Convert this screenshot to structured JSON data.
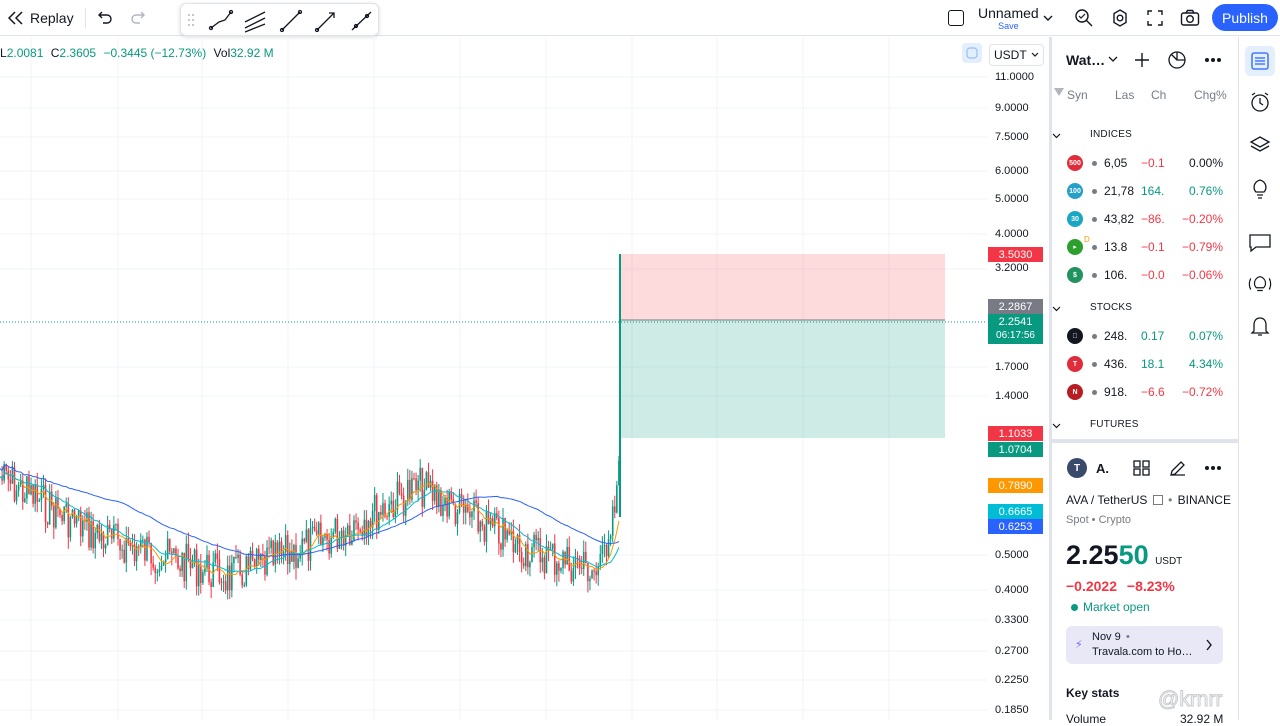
{
  "topbar": {
    "replay_label": "Replay",
    "layout_name": "Unnamed",
    "save_label": "Save",
    "publish_label": "Publish"
  },
  "legend": {
    "low_key": "L",
    "low_val": "2.0081",
    "close_key": "C",
    "close_val": "2.3605",
    "change_val": "−0.3445 (−12.73%)",
    "vol_key": "Vol",
    "vol_val": "32.92 M"
  },
  "price_axis": {
    "currency": "USDT",
    "ticks": [
      "11.0000",
      "9.0000",
      "7.5000",
      "6.0000",
      "5.0000",
      "4.0000",
      "3.2000",
      "1.7000",
      "1.4000",
      "0.5000",
      "0.4000",
      "0.3300",
      "0.2700",
      "0.2250",
      "0.1850"
    ],
    "labels": {
      "stop": "3.5030",
      "hi": "2.2867",
      "last": "2.2541",
      "countdown": "06:17:56",
      "target": "1.1033",
      "target2": "1.0704",
      "ema1": "0.7890",
      "ema2": "0.6665",
      "ema3": "0.6253"
    },
    "colors": {
      "stop": "#f23645",
      "hi": "#787b86",
      "last": "#089981",
      "ema1": "#ff9800",
      "ema2": "#00bcd4",
      "ema3": "#2962ff"
    }
  },
  "watchlist": {
    "title": "Wat…",
    "columns": [
      "Syn",
      "Las",
      "Ch",
      "Chg%"
    ],
    "sections": [
      {
        "name": "INDICES",
        "rows": [
          {
            "logo": "500",
            "color": "#e02d39",
            "last": "6,05",
            "chg": "−0.1",
            "pct": "0.00%",
            "dir": "down",
            "pdir": "flat"
          },
          {
            "logo": "100",
            "color": "#26a0c8",
            "last": "21,78",
            "chg": "164.",
            "pct": "0.76%",
            "dir": "up",
            "pdir": "up"
          },
          {
            "logo": "30",
            "color": "#1aa7c4",
            "last": "43,82",
            "chg": "−86.",
            "pct": "−0.20%",
            "dir": "down",
            "pdir": "down"
          },
          {
            "logo": "▸",
            "color": "#2ca02c",
            "last": "13.8",
            "chg": "−0.1",
            "pct": "−0.79%",
            "dir": "down",
            "pdir": "down",
            "prefix": "D"
          },
          {
            "logo": "$",
            "color": "#21935f",
            "last": "106.",
            "chg": "−0.0",
            "pct": "−0.06%",
            "dir": "down",
            "pdir": "down"
          }
        ]
      },
      {
        "name": "STOCKS",
        "rows": [
          {
            "logo": "",
            "color": "#131722",
            "last": "248.",
            "chg": "0.17",
            "pct": "0.07%",
            "dir": "up",
            "pdir": "up"
          },
          {
            "logo": "T",
            "color": "#e02d39",
            "last": "436.",
            "chg": "18.1",
            "pct": "4.34%",
            "dir": "up",
            "pdir": "up"
          },
          {
            "logo": "N",
            "color": "#b81d24",
            "last": "918.",
            "chg": "−6.6",
            "pct": "−0.72%",
            "dir": "down",
            "pdir": "down"
          }
        ]
      },
      {
        "name": "FUTURES",
        "rows": []
      }
    ]
  },
  "details": {
    "symbol_short": "A.",
    "pair": "AVA / TetherUS",
    "exchange": "BINANCE",
    "type": "Spot • Crypto",
    "price_main": "2.25",
    "price_tail": "50",
    "price_unit": "USDT",
    "change_abs": "−0.2022",
    "change_pct": "−8.23%",
    "market_status": "Market open",
    "news_date": "Nov 9",
    "news_title": "Travala.com to Ho…",
    "key_stats_title": "Key stats",
    "volume_label": "Volume",
    "volume_val": "32.92 M"
  },
  "watermark": "@krnrr"
}
